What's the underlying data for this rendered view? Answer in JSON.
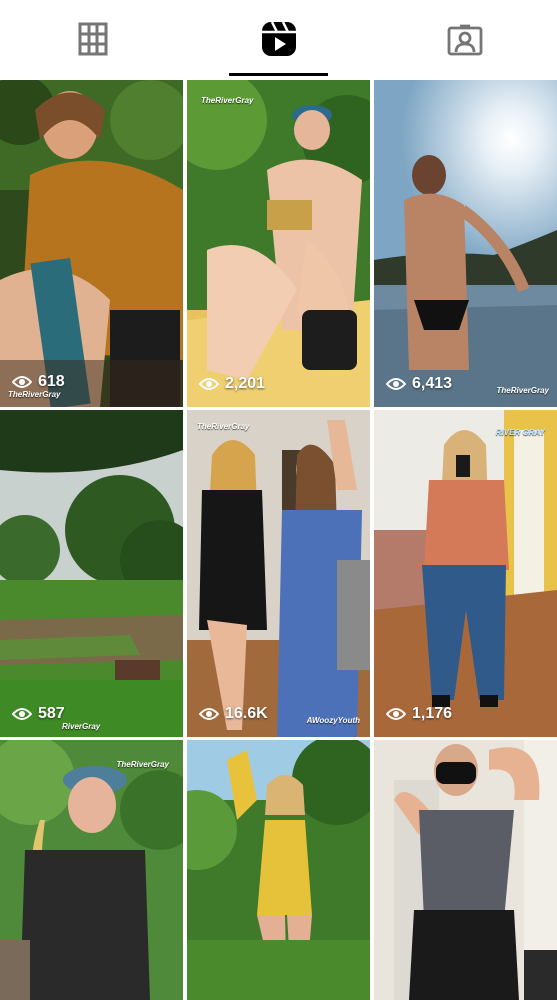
{
  "tabs": [
    {
      "name": "Posts grid",
      "icon": "grid-icon"
    },
    {
      "name": "Reels",
      "icon": "reels-icon",
      "active": true
    },
    {
      "name": "Tagged",
      "icon": "tagged-icon"
    }
  ],
  "colors": {
    "accent": "#000000",
    "background": "#ffffff",
    "overlay_text": "#ffffff"
  },
  "posts": [
    {
      "views": "618",
      "watermark": "TheRiverGray"
    },
    {
      "views": "2,201",
      "watermark": "TheRiverGray"
    },
    {
      "views": "6,413",
      "watermark": "TheRiverGray"
    },
    {
      "views": "587",
      "watermark": "RiverGray"
    },
    {
      "views": "16.6K",
      "watermark": "TheRiverGray",
      "watermark2": "AWoozyYouth"
    },
    {
      "views": "1,176",
      "watermark": "RIVER GRAY"
    },
    {
      "watermark": "TheRiverGray"
    },
    {},
    {}
  ]
}
